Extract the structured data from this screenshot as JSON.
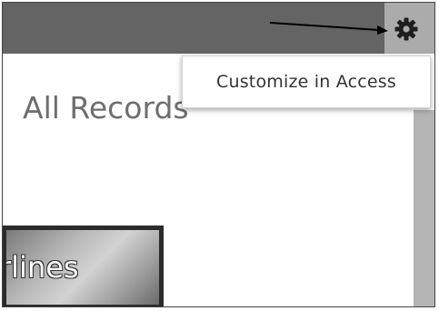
{
  "header": {
    "settings_icon": "gear-icon",
    "colors": {
      "bar_dark": "#646464",
      "bar_light": "#ababab"
    }
  },
  "menu": {
    "items": [
      {
        "label": "Customize in Access"
      }
    ]
  },
  "main": {
    "title": "All Records",
    "banner_text": "rlines"
  }
}
